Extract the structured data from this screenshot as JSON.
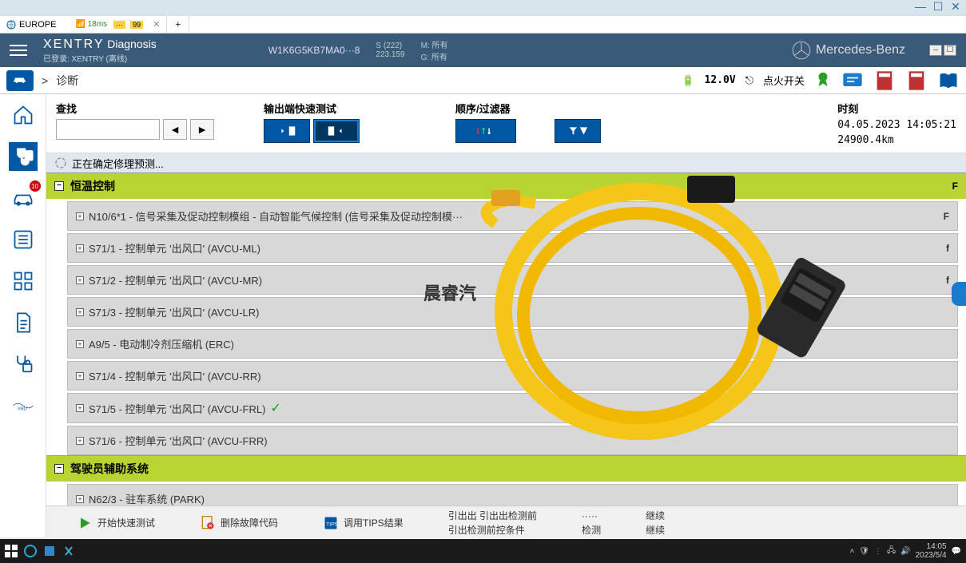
{
  "window": {
    "title": "EUROPE",
    "ping": "18ms",
    "min": "—",
    "max": "☐",
    "close": "✕"
  },
  "tab": {
    "title": "EUROPE"
  },
  "header": {
    "brand_main": "XENTRY",
    "brand_diag": "Diagnosis",
    "brand_sub": "已登录: XENTRY (离线)",
    "vin": "W1K6G5KB7MA0···8",
    "vin_sub1": "S (222)",
    "vin_sub2": "223.159",
    "m_label": "M: 所有",
    "g_label": "G: 所有",
    "company": "Mercedes-Benz"
  },
  "breadcrumb": {
    "arrow": ">",
    "text": "诊断",
    "voltage_icon": "🔋",
    "voltage": "12.0V",
    "ign_icon": "▸",
    "ignition": "点火开关"
  },
  "filters": {
    "search_label": "查找",
    "output_label": "输出端快速测试",
    "order_label": "顺序/过滤器",
    "time_label": "时刻",
    "timestamp": "04.05.2023 14:05:21",
    "odometer": "24900.4km"
  },
  "status": {
    "text": "正在确定修理预测..."
  },
  "groups": [
    {
      "name": "恒温控制",
      "flag": "F",
      "open": true,
      "items": [
        {
          "label": "N10/6*1 - 信号采集及促动控制模组 - 自动智能气候控制 (信号采集及促动控制模···",
          "flag": "F"
        },
        {
          "label": "S71/1 - 控制单元 '出风口' (AVCU-ML)",
          "flag": "f"
        },
        {
          "label": "S71/2 - 控制单元 '出风口' (AVCU-MR)",
          "flag": "f"
        },
        {
          "label": "S71/3 - 控制单元 '出风口' (AVCU-LR)",
          "flag": ""
        },
        {
          "label": "A9/5 - 电动制冷剂压缩机 (ERC)",
          "flag": ""
        },
        {
          "label": "S71/4 - 控制单元 '出风口' (AVCU-RR)",
          "flag": ""
        },
        {
          "label": "S71/5 - 控制单元 '出风口' (AVCU-FRL)",
          "flag": "✓"
        },
        {
          "label": "S71/6 - 控制单元 '出风口' (AVCU-FRR)",
          "flag": ""
        }
      ]
    },
    {
      "name": "驾驶员辅助系统",
      "flag": "",
      "open": true,
      "items": [
        {
          "label": "N62/3 - 驻车系统 (PARK)",
          "flag": ""
        }
      ]
    }
  ],
  "bottom_buttons": {
    "b1": "开始快速测试",
    "b2": "删除故障代码",
    "b3": "调用TIPS结果",
    "b4a": "引出出 引出出检测前",
    "b4b": "引出检测前控条件",
    "b5a": "·····",
    "b5b": "检测",
    "b6a": "继续",
    "b6b": "继续"
  },
  "watermark": "晨睿汽",
  "taskbar": {
    "time": "14:05",
    "date": "2023/5/4"
  },
  "rail_badge": "10"
}
